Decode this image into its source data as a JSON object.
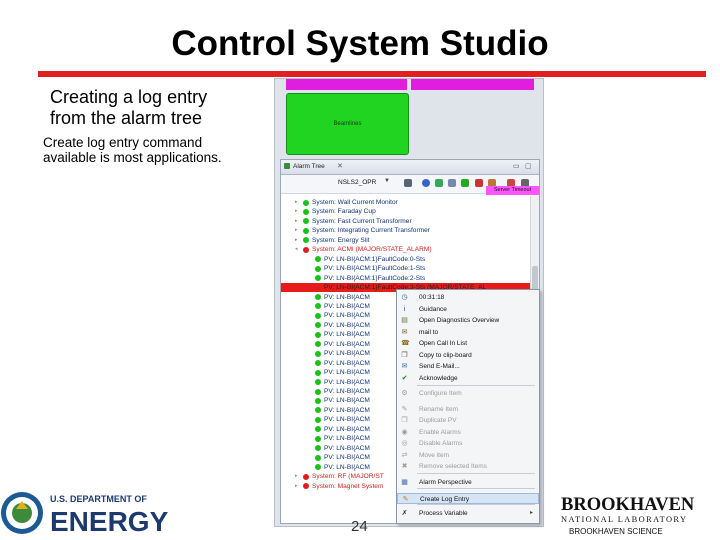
{
  "title": "Control System Studio",
  "subtitle": [
    "Creating a log entry",
    "from the alarm tree"
  ],
  "note": [
    "Create log entry command",
    "available is most applications."
  ],
  "screenshot": {
    "tile_label": "Beamlines",
    "view_title": "Alarm Tree",
    "config_combo": "NSLS2_OPR",
    "server_badge": "Server Timeout",
    "tree": [
      {
        "text": "System: Wall Current Monitor",
        "level": 0,
        "state": "ok",
        "expand": "▸"
      },
      {
        "text": "System: Faraday Cup",
        "level": 0,
        "state": "ok",
        "expand": "▸"
      },
      {
        "text": "System: Fast Current Transformer",
        "level": 0,
        "state": "ok",
        "expand": "▸"
      },
      {
        "text": "System: Integrating Current Transformer",
        "level": 0,
        "state": "ok",
        "expand": "▸"
      },
      {
        "text": "System: Energy Slit",
        "level": 0,
        "state": "ok",
        "expand": "▸"
      },
      {
        "text": "System: ACMI (MAJOR/STATE_ALARM)",
        "level": 0,
        "state": "alarm",
        "expand": "◂"
      },
      {
        "text": "PV: LN-BI{ACM:1}FaultCode:0-Sts",
        "level": 1,
        "state": "ok"
      },
      {
        "text": "PV: LN-BI{ACM:1}FaultCode:1-Sts",
        "level": 1,
        "state": "ok"
      },
      {
        "text": "PV: LN-BI{ACM:1}FaultCode:2-Sts",
        "level": 1,
        "state": "ok"
      },
      {
        "text": "PV: LN-BI{ACM:1}FaultCode:3-Sts (MAJOR/STATE_AL",
        "level": 1,
        "state": "alarm",
        "selected": true
      },
      {
        "text": "PV: LN-BI{ACM",
        "level": 1,
        "state": "ok"
      },
      {
        "text": "PV: LN-BI{ACM",
        "level": 1,
        "state": "ok"
      },
      {
        "text": "PV: LN-BI{ACM",
        "level": 1,
        "state": "ok"
      },
      {
        "text": "PV: LN-BI{ACM",
        "level": 1,
        "state": "ok"
      },
      {
        "text": "PV: LN-BI{ACM",
        "level": 1,
        "state": "ok"
      },
      {
        "text": "PV: LN-BI{ACM",
        "level": 1,
        "state": "ok"
      },
      {
        "text": "PV: LN-BI{ACM",
        "level": 1,
        "state": "ok"
      },
      {
        "text": "PV: LN-BI{ACM",
        "level": 1,
        "state": "ok"
      },
      {
        "text": "PV: LN-BI{ACM",
        "level": 1,
        "state": "ok"
      },
      {
        "text": "PV: LN-BI{ACM",
        "level": 1,
        "state": "ok"
      },
      {
        "text": "PV: LN-BI{ACM",
        "level": 1,
        "state": "ok"
      },
      {
        "text": "PV: LN-BI{ACM",
        "level": 1,
        "state": "ok"
      },
      {
        "text": "PV: LN-BI{ACM",
        "level": 1,
        "state": "ok"
      },
      {
        "text": "PV: LN-BI{ACM",
        "level": 1,
        "state": "ok"
      },
      {
        "text": "PV: LN-BI{ACM",
        "level": 1,
        "state": "ok"
      },
      {
        "text": "PV: LN-BI{ACM",
        "level": 1,
        "state": "ok"
      },
      {
        "text": "PV: LN-BI{ACM",
        "level": 1,
        "state": "ok"
      },
      {
        "text": "PV: LN-BI{ACM",
        "level": 1,
        "state": "ok"
      },
      {
        "text": "PV: LN-BI{ACM",
        "level": 1,
        "state": "ok"
      },
      {
        "text": "System: RF (MAJOR/ST",
        "level": 0,
        "state": "alarm",
        "expand": "▸"
      },
      {
        "text": "System: Magnet System",
        "level": 0,
        "state": "alarm",
        "expand": "▸"
      }
    ],
    "menu": [
      {
        "label": "00:31:18",
        "icon": "◷",
        "icon_color": "#3c5a8a",
        "disabled": false
      },
      {
        "label": "Guidance",
        "icon": "i",
        "icon_color": "#2255aa",
        "disabled": false
      },
      {
        "label": "Open Diagnostics Overview",
        "icon": "▤",
        "icon_color": "#4a7a30",
        "disabled": false
      },
      {
        "label": "mail to",
        "icon": "✉",
        "icon_color": "#7a5a20",
        "disabled": false
      },
      {
        "label": "Open Call In List",
        "icon": "☎",
        "icon_color": "#8a6a10",
        "disabled": false
      },
      {
        "label": "Copy to clip-board",
        "icon": "❐",
        "icon_color": "#5a5a5a",
        "disabled": false
      },
      {
        "label": "Send E-Mail...",
        "icon": "✉",
        "icon_color": "#2a6aaa",
        "disabled": false
      },
      {
        "label": "Acknowledge",
        "icon": "✔",
        "icon_color": "#1a8a1a",
        "disabled": false
      },
      {
        "label": "Configure Item",
        "icon": "⚙",
        "icon_color": "#9a9a9a",
        "disabled": true
      },
      {
        "label": "Rename Item",
        "icon": "✎",
        "icon_color": "#9a9a9a",
        "disabled": true
      },
      {
        "label": "Duplicate PV",
        "icon": "❐",
        "icon_color": "#9a9a9a",
        "disabled": true
      },
      {
        "label": "Enable Alarms",
        "icon": "◉",
        "icon_color": "#9a9a9a",
        "disabled": true
      },
      {
        "label": "Disable Alarms",
        "icon": "◎",
        "icon_color": "#9a9a9a",
        "disabled": true
      },
      {
        "label": "Move item",
        "icon": "⇄",
        "icon_color": "#9a9a9a",
        "disabled": true
      },
      {
        "label": "Remove selected Items",
        "icon": "✖",
        "icon_color": "#9a9a9a",
        "disabled": true
      },
      {
        "label": "Alarm Perspective",
        "icon": "▦",
        "icon_color": "#3a6aaa",
        "disabled": false
      },
      {
        "label": "Create Log Entry",
        "icon": "✎",
        "icon_color": "#c07a10",
        "disabled": false,
        "highlighted": true
      },
      {
        "label": "Process Variable",
        "icon": "✗",
        "icon_color": "#333333",
        "disabled": false,
        "submenu": true
      }
    ]
  },
  "footer": {
    "page_number": "24",
    "doe_line1": "U.S. DEPARTMENT OF",
    "doe_line2": "ENERGY",
    "bnl_line1": "BROOKHAVEN",
    "bnl_line2": "NATIONAL LABORATORY",
    "bnl_line3": "BROOKHAVEN SCIENCE"
  },
  "colors": {
    "title_rule": "#e02020",
    "alarm": "#e21c1c",
    "ok": "#19c219",
    "magenta": "#e01ee0"
  }
}
